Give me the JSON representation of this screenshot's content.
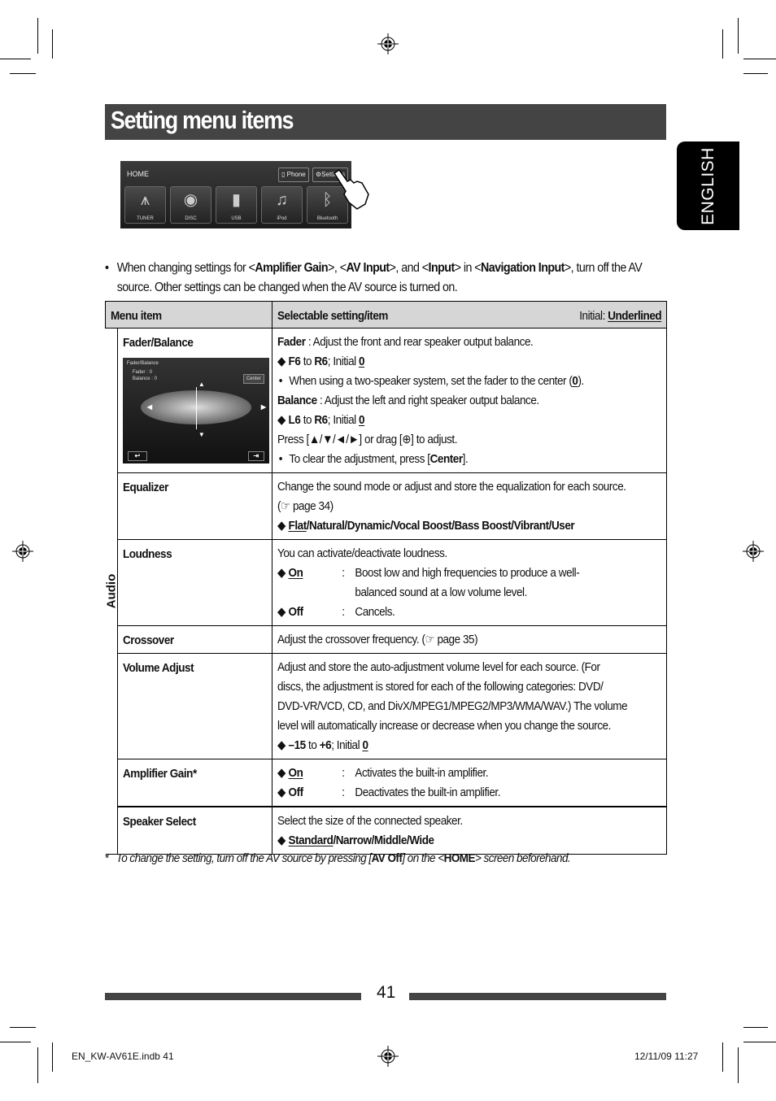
{
  "page": {
    "title": "Setting menu items",
    "language_tab": "ENGLISH",
    "page_number": "41",
    "slug_left": "EN_KW-AV61E.indb   41",
    "slug_right": "12/11/09   11:27"
  },
  "home_screen": {
    "label": "HOME",
    "buttons": [
      "Phone",
      "Settings"
    ],
    "tiles": [
      {
        "label": "TUNER",
        "icon": "antenna-icon"
      },
      {
        "label": "DISC",
        "icon": "disc-icon"
      },
      {
        "label": "USB",
        "icon": "usb-icon"
      },
      {
        "label": "iPod",
        "icon": "ipod-icon"
      },
      {
        "label": "Bluetooth",
        "icon": "bluetooth-icon"
      }
    ]
  },
  "note": {
    "p1": "When changing settings for <",
    "b1": "Amplifier Gain",
    "p2": ">, <",
    "b2": "AV Input",
    "p3": ">, and <",
    "b3": "Input",
    "p4": "> in <",
    "b4": "Navigation Input",
    "p5": ">, turn off the AV source. Other settings can be changed when the AV source is turned on."
  },
  "table": {
    "header_menu_item": "Menu item",
    "header_selectable": "Selectable setting/item",
    "header_initial_prefix": "Initial: ",
    "header_initial_value": "Underlined",
    "group_label": "Audio",
    "fader_screen": {
      "title": "Fader/Balance",
      "fader_label": "Fader",
      "fader_value": ": 0",
      "balance_label": "Balance",
      "balance_value": ": 0",
      "center_button": "Center"
    },
    "rows": [
      {
        "name": "Fader/Balance",
        "fader_label": "Fader",
        "fader_desc": " : Adjust the front and rear speaker output balance.",
        "fader_range_from": "F6",
        "fader_range_to": "R6",
        "fader_initial": "0",
        "fader_note": "When using a two-speaker system, set the fader to the center (",
        "fader_note_val": "0",
        "balance_label": "Balance",
        "balance_desc": " : Adjust the left and right speaker output balance.",
        "balance_range_from": "L6",
        "balance_range_to": "R6",
        "balance_initial": "0",
        "press_text_a": "Press [▲/▼/◄/►] or drag [",
        "press_text_b": "] to adjust.",
        "clear_note": "To clear the adjustment, press [",
        "clear_button": "Center",
        "clear_note_end": "]."
      },
      {
        "name": "Equalizer",
        "desc": "Change the sound mode or adjust and store the equalization for each source.",
        "ref": "(☞ page 34)",
        "options_initial": "Flat",
        "options_rest": "/Natural/Dynamic/Vocal Boost/Bass Boost/Vibrant/User"
      },
      {
        "name": "Loudness",
        "desc": "You can activate/deactivate loudness.",
        "options": [
          {
            "label": "On",
            "initial": true,
            "desc": "Boost low and high frequencies to produce a well-",
            "desc2": "balanced sound at a low volume level."
          },
          {
            "label": "Off",
            "initial": false,
            "desc": "Cancels."
          }
        ]
      },
      {
        "name": "Crossover",
        "desc": "Adjust the crossover frequency. (☞ page 35)"
      },
      {
        "name": "Volume Adjust",
        "lines": [
          "Adjust and store the auto-adjustment volume level for each source. (For",
          "discs, the adjustment is stored for each of the following categories: DVD/",
          "DVD-VR/VCD, CD, and DivX/MPEG1/MPEG2/MP3/WMA/WAV.) The volume",
          "level will automatically increase or decrease when you change the source."
        ],
        "range_from": "–15",
        "range_to": "+6",
        "initial": "0"
      },
      {
        "name": "Amplifier Gain*",
        "options": [
          {
            "label": "On",
            "initial": true,
            "desc": "Activates the built-in amplifier."
          },
          {
            "label": "Off",
            "initial": false,
            "desc": "Deactivates the built-in amplifier."
          }
        ]
      },
      {
        "name": "Speaker Select",
        "desc": "Select the size of the connected speaker.",
        "options_initial": "Standard",
        "options_rest": "/Narrow/Middle/Wide"
      }
    ]
  },
  "footnote": {
    "mark": "*",
    "p1": "To change the setting, turn off the AV source by pressing [",
    "b1": "AV Off",
    "p2": "] on the <",
    "b2": "HOME",
    "p3": "> screen beforehand."
  },
  "common": {
    "to": " to ",
    "initial": "; Initial ",
    "colon": ":",
    "diamond": "◆"
  }
}
